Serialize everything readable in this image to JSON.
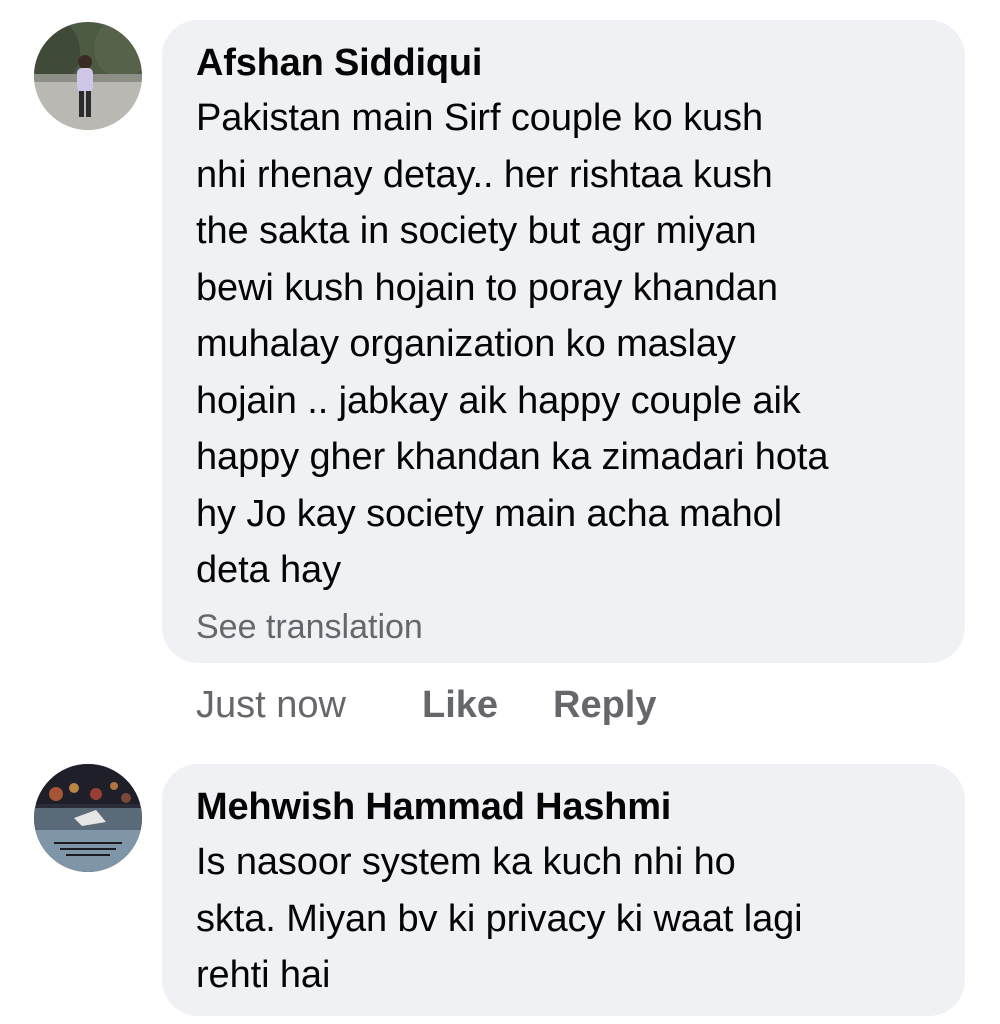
{
  "comments": [
    {
      "author": "Afshan Siddiqui",
      "avatar_icon": "user-photo-avatar",
      "text_lines": [
        "Pakistan main Sirf couple ko kush",
        "nhi rhenay detay.. her rishtaa kush",
        "the sakta in society but agr miyan",
        "bewi kush hojain to poray khandan",
        "muhalay organization ko maslay",
        "hojain .. jabkay aik happy couple aik",
        "happy gher khandan ka zimadari hota",
        "hy Jo kay society main acha mahol",
        "deta hay"
      ],
      "see_translation": "See translation",
      "time": "Just now",
      "like_label": "Like",
      "reply_label": "Reply"
    },
    {
      "author": "Mehwish Hammad Hashmi",
      "avatar_icon": "user-photo-avatar",
      "text_lines": [
        "Is nasoor system ka kuch nhi ho",
        "skta. Miyan bv ki privacy ki waat lagi",
        "rehti hai"
      ]
    }
  ],
  "colors": {
    "bubble_bg": "#eff1f5",
    "secondary_text": "#65676b",
    "primary_text": "#050505"
  }
}
